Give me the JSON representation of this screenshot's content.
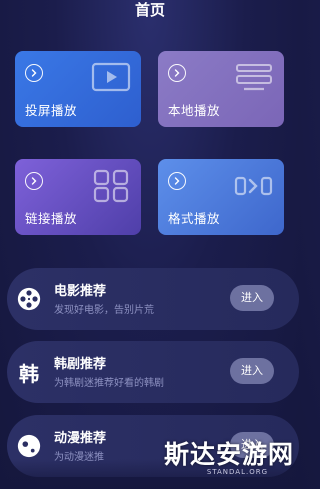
{
  "header": {
    "title": "首页"
  },
  "colors": {
    "background": "#1b1d4c",
    "card_screencast": "#3a78e6",
    "card_local": "#8b7bc6",
    "card_link": "#7e61d9",
    "card_format": "#5d8fea",
    "row_background": "#2a2e62",
    "enter_button": "#6d71a0"
  },
  "cards": [
    {
      "label": "投屏播放",
      "icon": "play-screen-icon"
    },
    {
      "label": "本地播放",
      "icon": "list-icon"
    },
    {
      "label": "链接播放",
      "icon": "link-icon"
    },
    {
      "label": "格式播放",
      "icon": "format-convert-icon"
    }
  ],
  "recommendations": [
    {
      "title": "电影推荐",
      "subtitle": "发现好电影，告别片荒",
      "button": "进入",
      "icon": "film-reel-icon"
    },
    {
      "title": "韩剧推荐",
      "subtitle": "为韩剧迷推荐好看的韩剧",
      "button": "进入",
      "icon_text": "韩"
    },
    {
      "title": "动漫推荐",
      "subtitle": "为动漫迷推",
      "button": "进入",
      "icon": "anime-icon"
    }
  ],
  "watermark": {
    "text": "斯达安游网",
    "url": "STANDAL.ORG"
  }
}
